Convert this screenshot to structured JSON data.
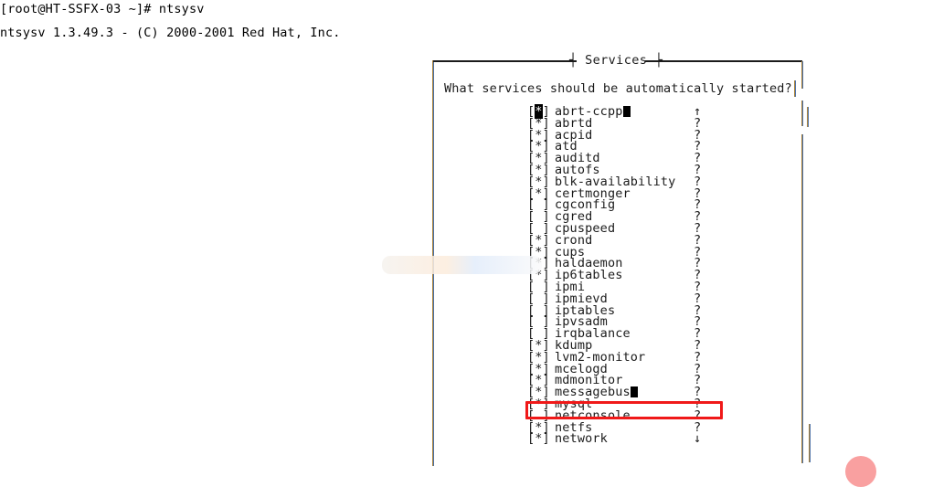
{
  "terminal": {
    "prompt_line": "[root@HT-SSFX-03 ~]# ntsysv",
    "version_line": "ntsysv 1.3.49.3 - (C) 2000-2001 Red Hat, Inc."
  },
  "dialog": {
    "title": "Services",
    "title_left_cap": "┤",
    "title_right_cap": "├",
    "question": "What services should be automatically started?",
    "right_edge_glyph": "│"
  },
  "scroll": {
    "up_arrow": "↑",
    "down_arrow": "↓",
    "marker": "?"
  },
  "list": {
    "checked_box": "[*]",
    "unchecked_box": "[ ]",
    "cursor_row_index": 0,
    "selected_row_index": 24,
    "services": [
      {
        "name": "abrt-ccpp",
        "checked": true,
        "indicator": "↑"
      },
      {
        "name": "abrtd",
        "checked": true,
        "indicator": "?"
      },
      {
        "name": "acpid",
        "checked": true,
        "indicator": "?"
      },
      {
        "name": "atd",
        "checked": true,
        "indicator": "?"
      },
      {
        "name": "auditd",
        "checked": true,
        "indicator": "?"
      },
      {
        "name": "autofs",
        "checked": true,
        "indicator": "?"
      },
      {
        "name": "blk-availability",
        "checked": true,
        "indicator": "?"
      },
      {
        "name": "certmonger",
        "checked": true,
        "indicator": "?"
      },
      {
        "name": "cgconfig",
        "checked": false,
        "indicator": "?"
      },
      {
        "name": "cgred",
        "checked": false,
        "indicator": "?"
      },
      {
        "name": "cpuspeed",
        "checked": false,
        "indicator": "?"
      },
      {
        "name": "crond",
        "checked": true,
        "indicator": "?"
      },
      {
        "name": "cups",
        "checked": true,
        "indicator": "?"
      },
      {
        "name": "haldaemon",
        "checked": true,
        "indicator": "?"
      },
      {
        "name": "ip6tables",
        "checked": true,
        "indicator": "?"
      },
      {
        "name": "ipmi",
        "checked": false,
        "indicator": "?"
      },
      {
        "name": "ipmievd",
        "checked": false,
        "indicator": "?"
      },
      {
        "name": "iptables",
        "checked": false,
        "indicator": "?"
      },
      {
        "name": "ipvsadm",
        "checked": false,
        "indicator": "?"
      },
      {
        "name": "irqbalance",
        "checked": false,
        "indicator": "?"
      },
      {
        "name": "kdump",
        "checked": true,
        "indicator": "?"
      },
      {
        "name": "lvm2-monitor",
        "checked": true,
        "indicator": "?"
      },
      {
        "name": "mcelogd",
        "checked": true,
        "indicator": "?"
      },
      {
        "name": "mdmonitor",
        "checked": true,
        "indicator": "?"
      },
      {
        "name": "messagebus",
        "checked": true,
        "indicator": "?"
      },
      {
        "name": "mysql",
        "checked": true,
        "indicator": "?"
      },
      {
        "name": "netconsole",
        "checked": false,
        "indicator": "?"
      },
      {
        "name": "netfs",
        "checked": true,
        "indicator": "?"
      },
      {
        "name": "network",
        "checked": true,
        "indicator": "↓"
      }
    ]
  },
  "annotation": {
    "target_service": "mysql",
    "color": "#f01919"
  },
  "decoration": {
    "circle_color": "#f9a0a0"
  }
}
